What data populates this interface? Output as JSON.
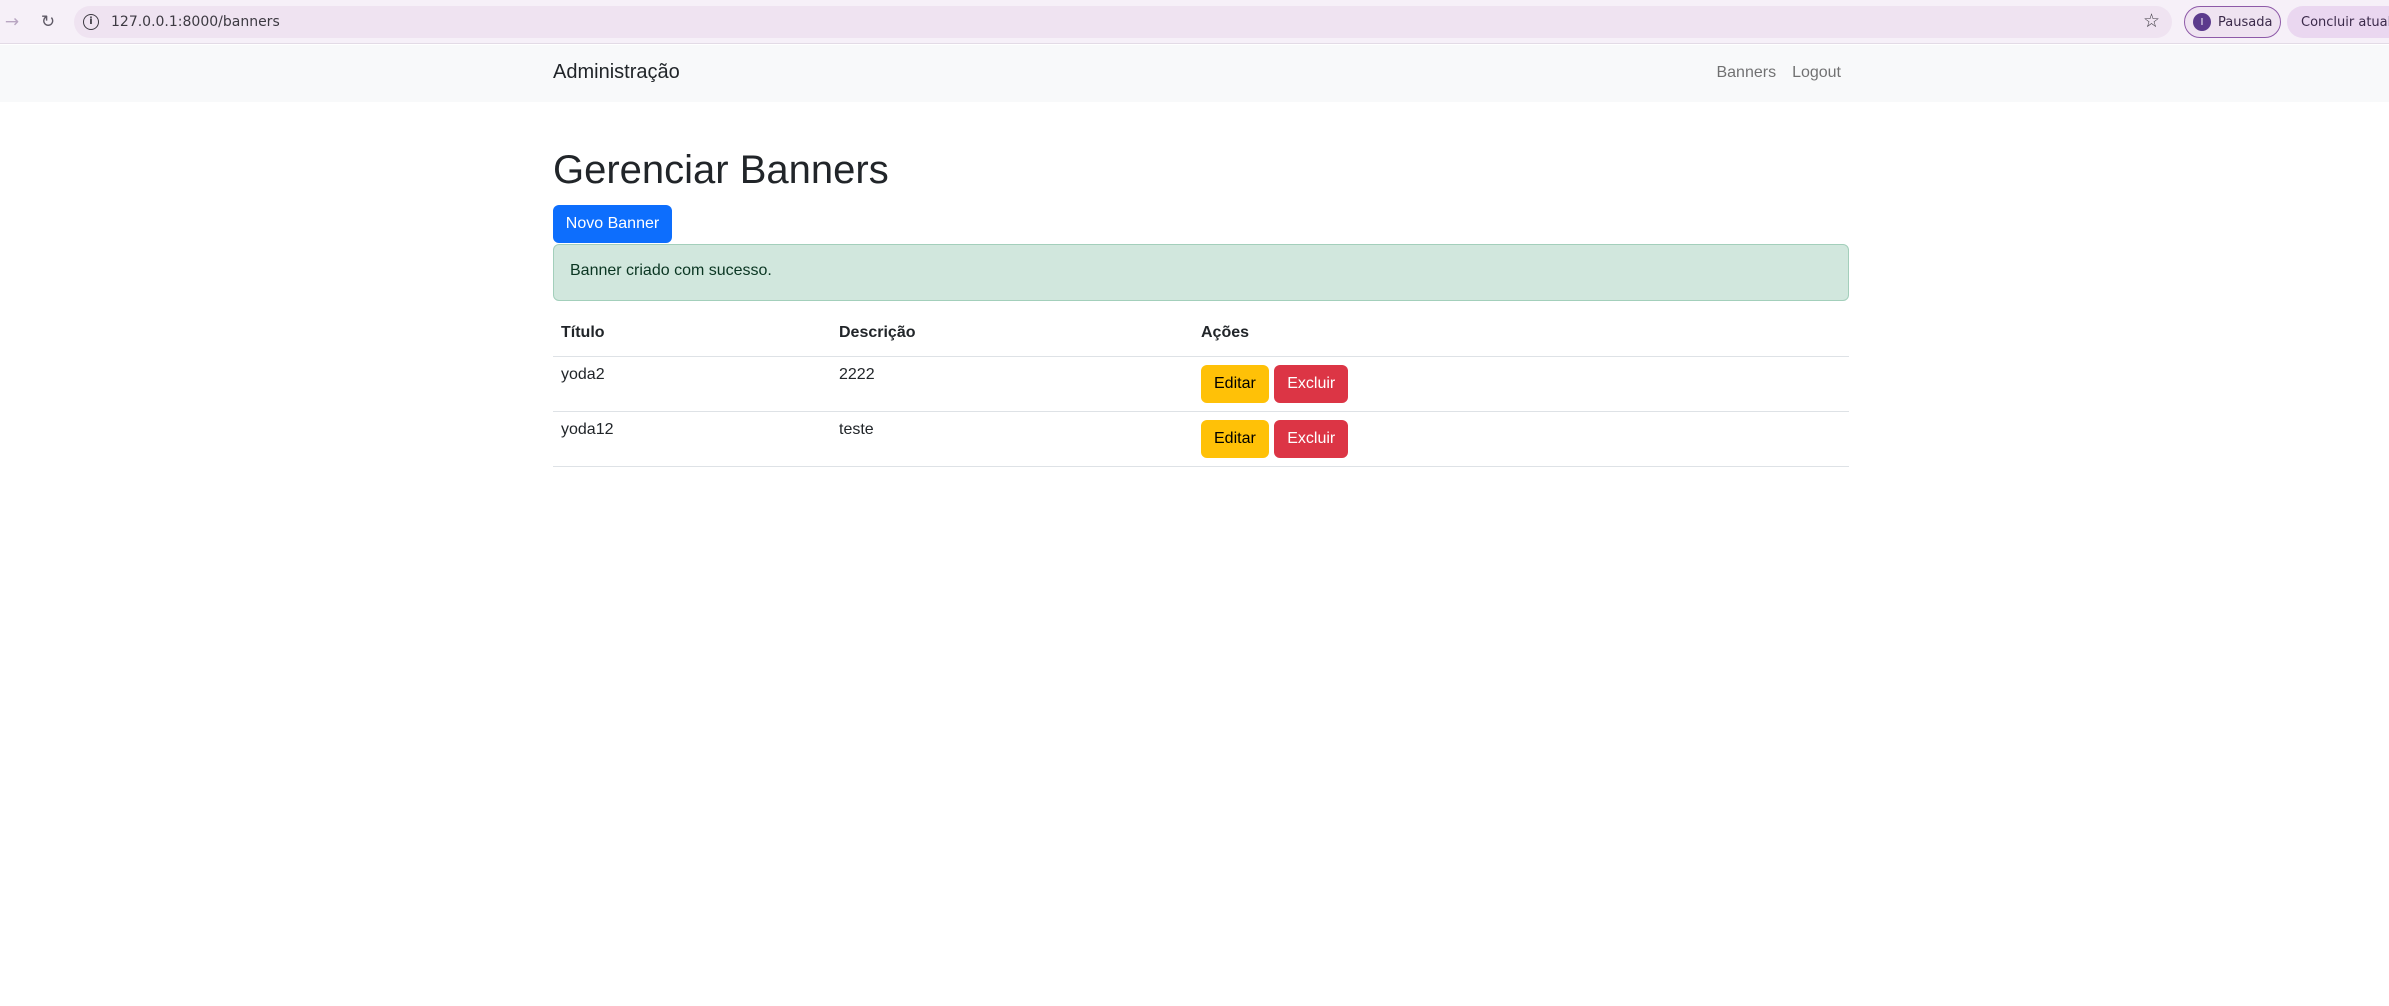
{
  "browser": {
    "url": "127.0.0.1:8000/banners",
    "profile_initial": "I",
    "profile_label": "Pausada",
    "update_label": "Concluir atualização"
  },
  "navbar": {
    "brand": "Administração",
    "links": [
      "Banners",
      "Logout"
    ]
  },
  "main": {
    "title": "Gerenciar Banners",
    "new_button": "Novo Banner",
    "alert": "Banner criado com sucesso.",
    "table": {
      "headers": [
        "Título",
        "Descrição",
        "Ações"
      ],
      "rows": [
        {
          "titulo": "yoda2",
          "descricao": "2222",
          "edit_label": "Editar",
          "delete_label": "Excluir"
        },
        {
          "titulo": "yoda12",
          "descricao": "teste",
          "edit_label": "Editar",
          "delete_label": "Excluir"
        }
      ]
    }
  },
  "colors": {
    "primary": "#0d6efd",
    "warning": "#ffc107",
    "danger": "#dc3545",
    "success_bg": "#d1e7dd"
  }
}
